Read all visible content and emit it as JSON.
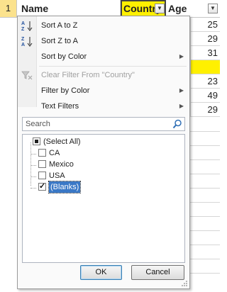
{
  "header": {
    "row_number": "1",
    "col_name": "Name",
    "col_country": "Country",
    "col_age": "Age"
  },
  "grid": {
    "values": [
      "25",
      "29",
      "31",
      "",
      "23",
      "49",
      "29"
    ]
  },
  "colors": {
    "highlight": "#fff000",
    "selection": "#3a78c6"
  },
  "menu": {
    "sort_az": "Sort A to Z",
    "sort_za": "Sort Z to A",
    "sort_color": "Sort by Color",
    "clear_filter": "Clear Filter From \"Country\"",
    "filter_color": "Filter by Color",
    "text_filters": "Text Filters",
    "search_placeholder": "Search",
    "items": [
      "(Select All)",
      "CA",
      "Mexico",
      "USA",
      "(Blanks)"
    ],
    "ok": "OK",
    "cancel": "Cancel"
  }
}
